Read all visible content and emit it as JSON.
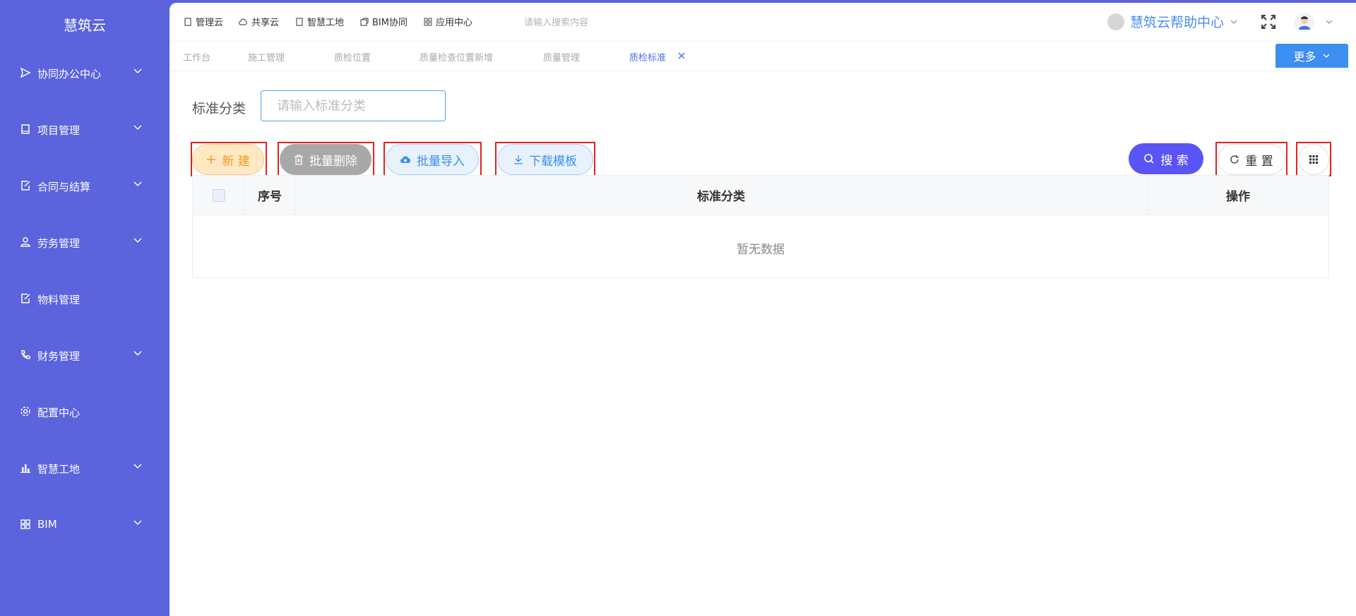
{
  "sidebar": {
    "brand": "慧筑云",
    "items": [
      {
        "label": "协同办公中心",
        "icon": "send-icon",
        "has_children": true
      },
      {
        "label": "项目管理",
        "icon": "book-icon",
        "has_children": true
      },
      {
        "label": "合同与结算",
        "icon": "edit-doc-icon",
        "has_children": true
      },
      {
        "label": "劳务管理",
        "icon": "worker-icon",
        "has_children": true
      },
      {
        "label": "物料管理",
        "icon": "edit-doc-icon",
        "has_children": false
      },
      {
        "label": "财务管理",
        "icon": "phone-icon",
        "has_children": true
      },
      {
        "label": "配置中心",
        "icon": "gear-icon",
        "has_children": false
      },
      {
        "label": "智慧工地",
        "icon": "bar-chart-icon",
        "has_children": true
      },
      {
        "label": "BIM",
        "icon": "grid-icon",
        "has_children": true
      }
    ]
  },
  "topbar": {
    "links": [
      {
        "label": "管理云",
        "icon": "book-icon"
      },
      {
        "label": "共享云",
        "icon": "cloud-icon"
      },
      {
        "label": "智慧工地",
        "icon": "book-icon"
      },
      {
        "label": "BIM协同",
        "icon": "cube-icon"
      },
      {
        "label": "应用中心",
        "icon": "grid-icon"
      }
    ],
    "search_placeholder": "请输入搜索内容",
    "help_label": "慧筑云帮助中心"
  },
  "tabs": {
    "items": [
      "工作台",
      "施工管理",
      "质检位置",
      "质量检查位置新增",
      "质量管理",
      "质检标准"
    ],
    "active": "质检标准",
    "more_label": "更多"
  },
  "filter": {
    "label": "标准分类",
    "placeholder": "请输入标准分类"
  },
  "actions": {
    "new_label": "新 建",
    "batch_delete_label": "批量删除",
    "batch_import_label": "批量导入",
    "download_template_label": "下载模板",
    "search_label": "搜 索",
    "reset_label": "重 置"
  },
  "table": {
    "columns": [
      "序号",
      "标准分类",
      "操作"
    ],
    "empty_text": "暂无数据"
  },
  "colors": {
    "sidebar": "#5b63dd",
    "accent": "#3c8ef0",
    "search_button": "#5a54f6",
    "highlight_box": "#e2231a"
  }
}
